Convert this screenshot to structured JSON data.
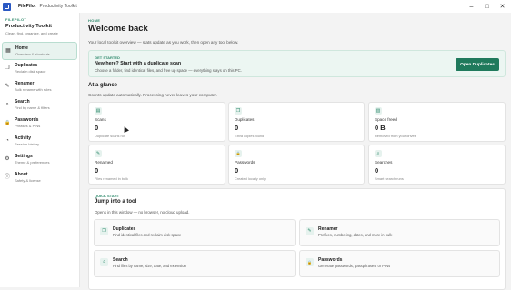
{
  "titlebar": {
    "app": "FilePilot",
    "subtitle": "Productivity Toolkit",
    "minimize": "–",
    "maximize": "□",
    "close": "✕"
  },
  "sidebar": {
    "brand_kicker": "FILEPILOT",
    "brand_name": "Productivity Toolkit",
    "brand_desc": "Clean, find, organize, and create",
    "items": [
      {
        "label": "Home",
        "sub": "Overview & shortcuts",
        "icon": "▦"
      },
      {
        "label": "Duplicates",
        "sub": "Reclaim disk space",
        "icon": "❐"
      },
      {
        "label": "Renamer",
        "sub": "Bulk rename with rules",
        "icon": "✎"
      },
      {
        "label": "Search",
        "sub": "Find by name & filters",
        "icon": "⌕"
      },
      {
        "label": "Passwords",
        "sub": "Phrases & PINs",
        "icon": "🔒"
      },
      {
        "label": "Activity",
        "sub": "Session history",
        "icon": "◔"
      },
      {
        "label": "Settings",
        "sub": "Theme & preferences",
        "icon": "⚙"
      },
      {
        "label": "About",
        "sub": "Safety & license",
        "icon": "ⓘ"
      }
    ]
  },
  "main": {
    "crumb": "HOME",
    "title": "Welcome back",
    "intro": "Your local toolkit overview — stats update as you work, then open any tool below.",
    "banner": {
      "kicker": "GET STARTED",
      "title": "New here? Start with a duplicate scan",
      "desc": "Choose a folder, find identical files, and free up space — everything stays on this PC.",
      "button": "Open Duplicates"
    },
    "glance_title": "At a glance",
    "glance_sub": "Counts update automatically. Processing never leaves your computer.",
    "stats": [
      {
        "label": "Scans",
        "value": "0",
        "sub": "Duplicate scans run",
        "icon": "▤"
      },
      {
        "label": "Duplicates",
        "value": "0",
        "sub": "Extra copies found",
        "icon": "❐"
      },
      {
        "label": "Space freed",
        "value": "0 B",
        "sub": "Removed from your drives",
        "icon": "▥"
      },
      {
        "label": "Renamed",
        "value": "0",
        "sub": "Files renamed in bulk",
        "icon": "✎"
      },
      {
        "label": "Passwords",
        "value": "0",
        "sub": "Created locally only",
        "icon": "🔒"
      },
      {
        "label": "Searches",
        "value": "0",
        "sub": "Smart search runs",
        "icon": "⌕"
      }
    ],
    "quickstart": {
      "kicker": "QUICK START",
      "title": "Jump into a tool",
      "desc": "Opens in this window — no browser, no cloud upload.",
      "tools": [
        {
          "label": "Duplicates",
          "desc": "Find identical files and reclaim disk space",
          "icon": "❐"
        },
        {
          "label": "Renamer",
          "desc": "Prefixes, numbering, dates, and more in bulk",
          "icon": "✎"
        },
        {
          "label": "Search",
          "desc": "Find files by name, size, date, and extension",
          "icon": "⌕"
        },
        {
          "label": "Passwords",
          "desc": "Generate passwords, passphrases, or PINs",
          "icon": "🔒"
        }
      ]
    }
  }
}
